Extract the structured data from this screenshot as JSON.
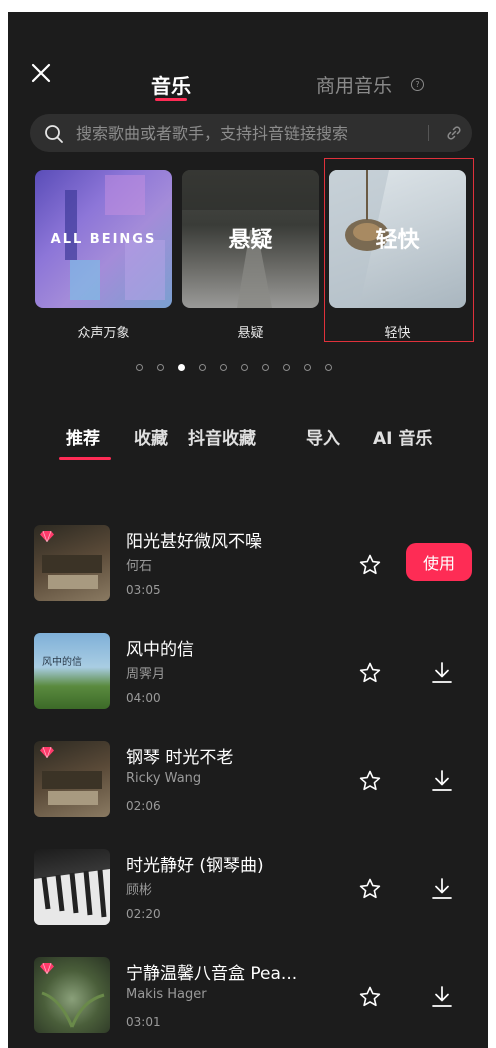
{
  "header": {
    "tab_music": "音乐",
    "tab_commercial": "商用音乐",
    "help_glyph": "?"
  },
  "search": {
    "placeholder": "搜索歌曲或者歌手，支持抖音链接搜索"
  },
  "cards": [
    {
      "image_text": "ALL BEINGS",
      "caption": "众声万象"
    },
    {
      "image_text": "悬疑",
      "caption": "悬疑"
    },
    {
      "image_text": "轻快",
      "caption": "轻快"
    }
  ],
  "pager": {
    "total": 10,
    "active_index": 2
  },
  "categories": [
    {
      "label": "推荐",
      "active": true
    },
    {
      "label": "收藏",
      "active": false
    },
    {
      "label": "抖音收藏",
      "active": false
    },
    {
      "label": "导入",
      "active": false
    },
    {
      "label": "AI 音乐",
      "active": false
    }
  ],
  "songs": [
    {
      "title": "阳光甚好微风不噪",
      "artist": "何石",
      "duration": "03:05",
      "vip": true,
      "action": "使用"
    },
    {
      "title": "风中的信",
      "artist": "周霁月",
      "duration": "04:00",
      "vip": false,
      "cover_text": "风中的信"
    },
    {
      "title": "钢琴 时光不老",
      "artist": "Ricky Wang",
      "duration": "02:06",
      "vip": true
    },
    {
      "title": "时光静好 (钢琴曲)",
      "artist": "顾彬",
      "duration": "02:20",
      "vip": false
    },
    {
      "title": "宁静温馨八音盒 Pea...",
      "artist": "Makis Hager",
      "duration": "03:01",
      "vip": true
    }
  ],
  "colors": {
    "accent": "#fe2c55",
    "background": "#1c1c1c",
    "highlight_box": "#e0313b"
  },
  "icons": [
    "close-icon",
    "help-icon",
    "search-icon",
    "link-icon",
    "star-icon",
    "download-icon",
    "vip-gem-icon"
  ]
}
